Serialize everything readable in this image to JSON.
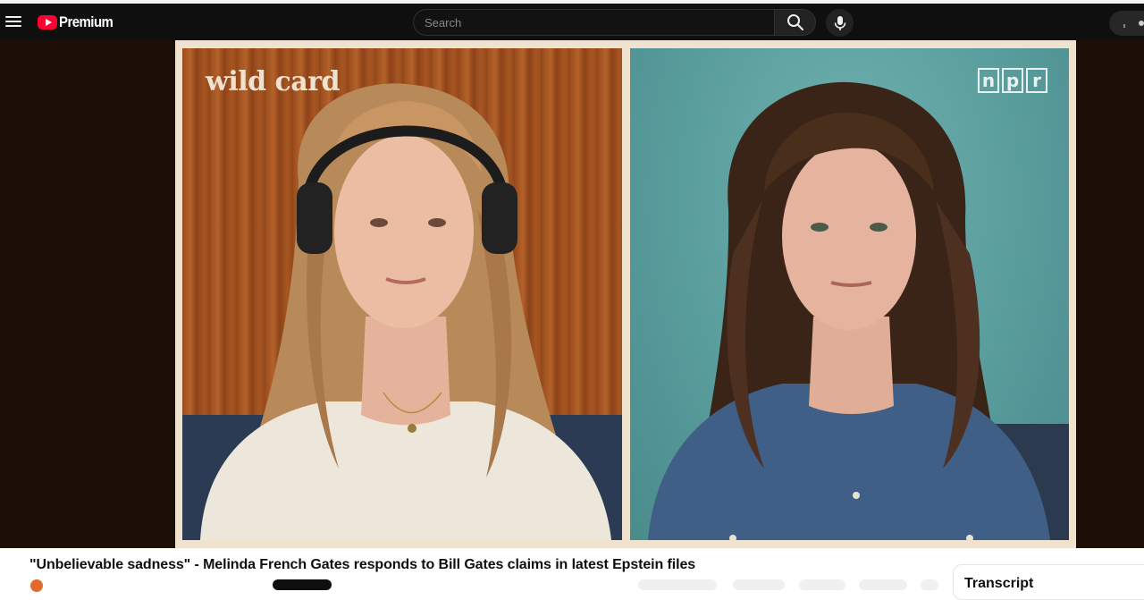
{
  "masthead": {
    "logo_text": "Premium",
    "search_placeholder": "Search",
    "icons": {
      "menu": "hamburger-icon",
      "logo": "youtube-play-icon",
      "search": "search-icon",
      "voice": "microphone-icon"
    }
  },
  "video": {
    "title": "\"Unbelievable sadness\" - Melinda French Gates responds to Bill Gates claims in latest Epstein files",
    "overlay_left": "wild card",
    "overlay_right_letters": [
      "n",
      "p",
      "r"
    ]
  },
  "side_panel": {
    "title": "Transcript"
  },
  "colors": {
    "masthead_bg": "#0f0f0f",
    "brand_red": "#ff0033",
    "player_bg": "#1c0f07",
    "frame": "#efe3cf",
    "left_backdrop": "#a3521f",
    "right_backdrop": "#5a9d9d"
  }
}
